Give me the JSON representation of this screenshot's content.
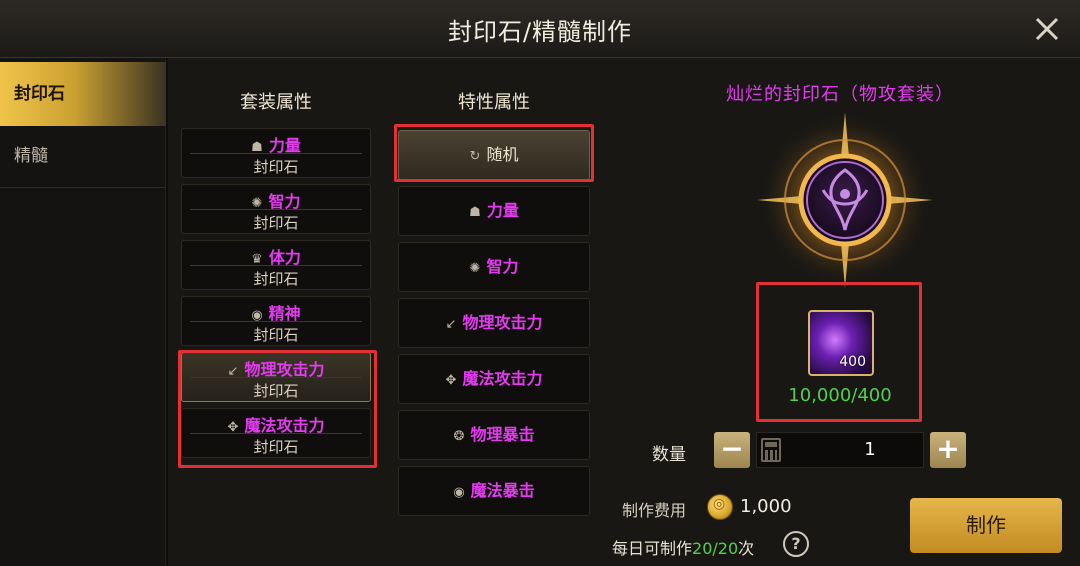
{
  "window": {
    "title": "封印石/精髓制作"
  },
  "sidebar": {
    "items": [
      {
        "label": "封印石",
        "active": true
      },
      {
        "label": "精髓",
        "active": false
      }
    ]
  },
  "set_column": {
    "header": "套装属性",
    "items": [
      {
        "label": "力量",
        "icon": "fist-icon",
        "sub": "封印石"
      },
      {
        "label": "智力",
        "icon": "brain-icon",
        "sub": "封印石"
      },
      {
        "label": "体力",
        "icon": "body-icon",
        "sub": "封印石"
      },
      {
        "label": "精神",
        "icon": "spirit-icon",
        "sub": "封印石"
      },
      {
        "label": "物理攻击力",
        "icon": "sword-icon",
        "sub": "封印石",
        "selected": true
      },
      {
        "label": "魔法攻击力",
        "icon": "magic-icon",
        "sub": "封印石"
      }
    ]
  },
  "trait_column": {
    "header": "特性属性",
    "items": [
      {
        "label": "随机",
        "icon": "refresh-icon",
        "selected": true
      },
      {
        "label": "力量",
        "icon": "fist-icon"
      },
      {
        "label": "智力",
        "icon": "brain-icon"
      },
      {
        "label": "物理攻击力",
        "icon": "sword-icon"
      },
      {
        "label": "魔法攻击力",
        "icon": "magic-icon"
      },
      {
        "label": "物理暴击",
        "icon": "crit-icon"
      },
      {
        "label": "魔法暴击",
        "icon": "spirit-icon"
      }
    ]
  },
  "result": {
    "title": "灿烂的封印石（物攻套装）",
    "material": {
      "count": "400",
      "ratio": "10,000/400"
    }
  },
  "quantity": {
    "label": "数量",
    "minus": "−",
    "plus": "+",
    "value": "1"
  },
  "cost": {
    "label": "制作费用",
    "value": "1,000"
  },
  "daily": {
    "prefix": "每日可制作",
    "count": "20/20",
    "suffix": "次"
  },
  "help": {
    "label": "?"
  },
  "make_button": {
    "label": "制作"
  },
  "colors": {
    "accent_gold": "#e6b64a",
    "magenta_text": "#e43bf0",
    "green_text": "#4fd04f",
    "highlight_red": "#e23035"
  }
}
